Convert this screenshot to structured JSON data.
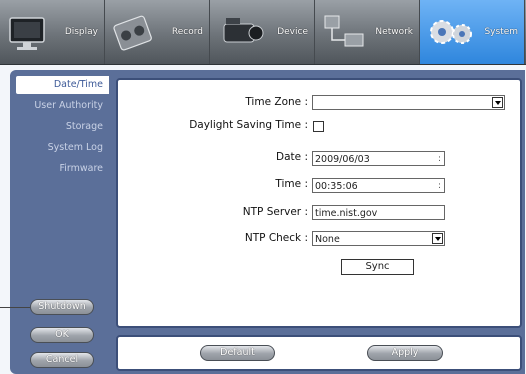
{
  "tabs": [
    {
      "label": "Display",
      "icon": "monitor-icon",
      "active": false
    },
    {
      "label": "Record",
      "icon": "reel-icon",
      "active": false
    },
    {
      "label": "Device",
      "icon": "camcorder-icon",
      "active": false
    },
    {
      "label": "Network",
      "icon": "network-icon",
      "active": false
    },
    {
      "label": "System",
      "icon": "gears-icon",
      "active": true
    }
  ],
  "menu": [
    "Date/Time",
    "User Authority",
    "Storage",
    "System Log",
    "Firmware"
  ],
  "menu_active": "Date/Time",
  "form": {
    "timezone_label": "Time Zone :",
    "timezone_value": "",
    "dst_label": "Daylight Saving Time :",
    "dst_checked": false,
    "date_label": "Date :",
    "date_value": "2009/06/03",
    "time_label": "Time :",
    "time_value": "00:35:06",
    "spin_glyph": ":",
    "ntp_server_label": "NTP Server :",
    "ntp_server_value": "time.nist.gov",
    "ntp_check_label": "NTP Check :",
    "ntp_check_value": "None",
    "sync_label": "Sync"
  },
  "side_buttons": {
    "shutdown": "Shutdown",
    "ok": "OK",
    "cancel": "Cancel"
  },
  "bottom_buttons": {
    "default": "Default",
    "apply": "Apply"
  },
  "colors": {
    "frame": "#5b6f99",
    "active_tab": "#2f86dd",
    "menu_active_text": "#3d5a98"
  }
}
